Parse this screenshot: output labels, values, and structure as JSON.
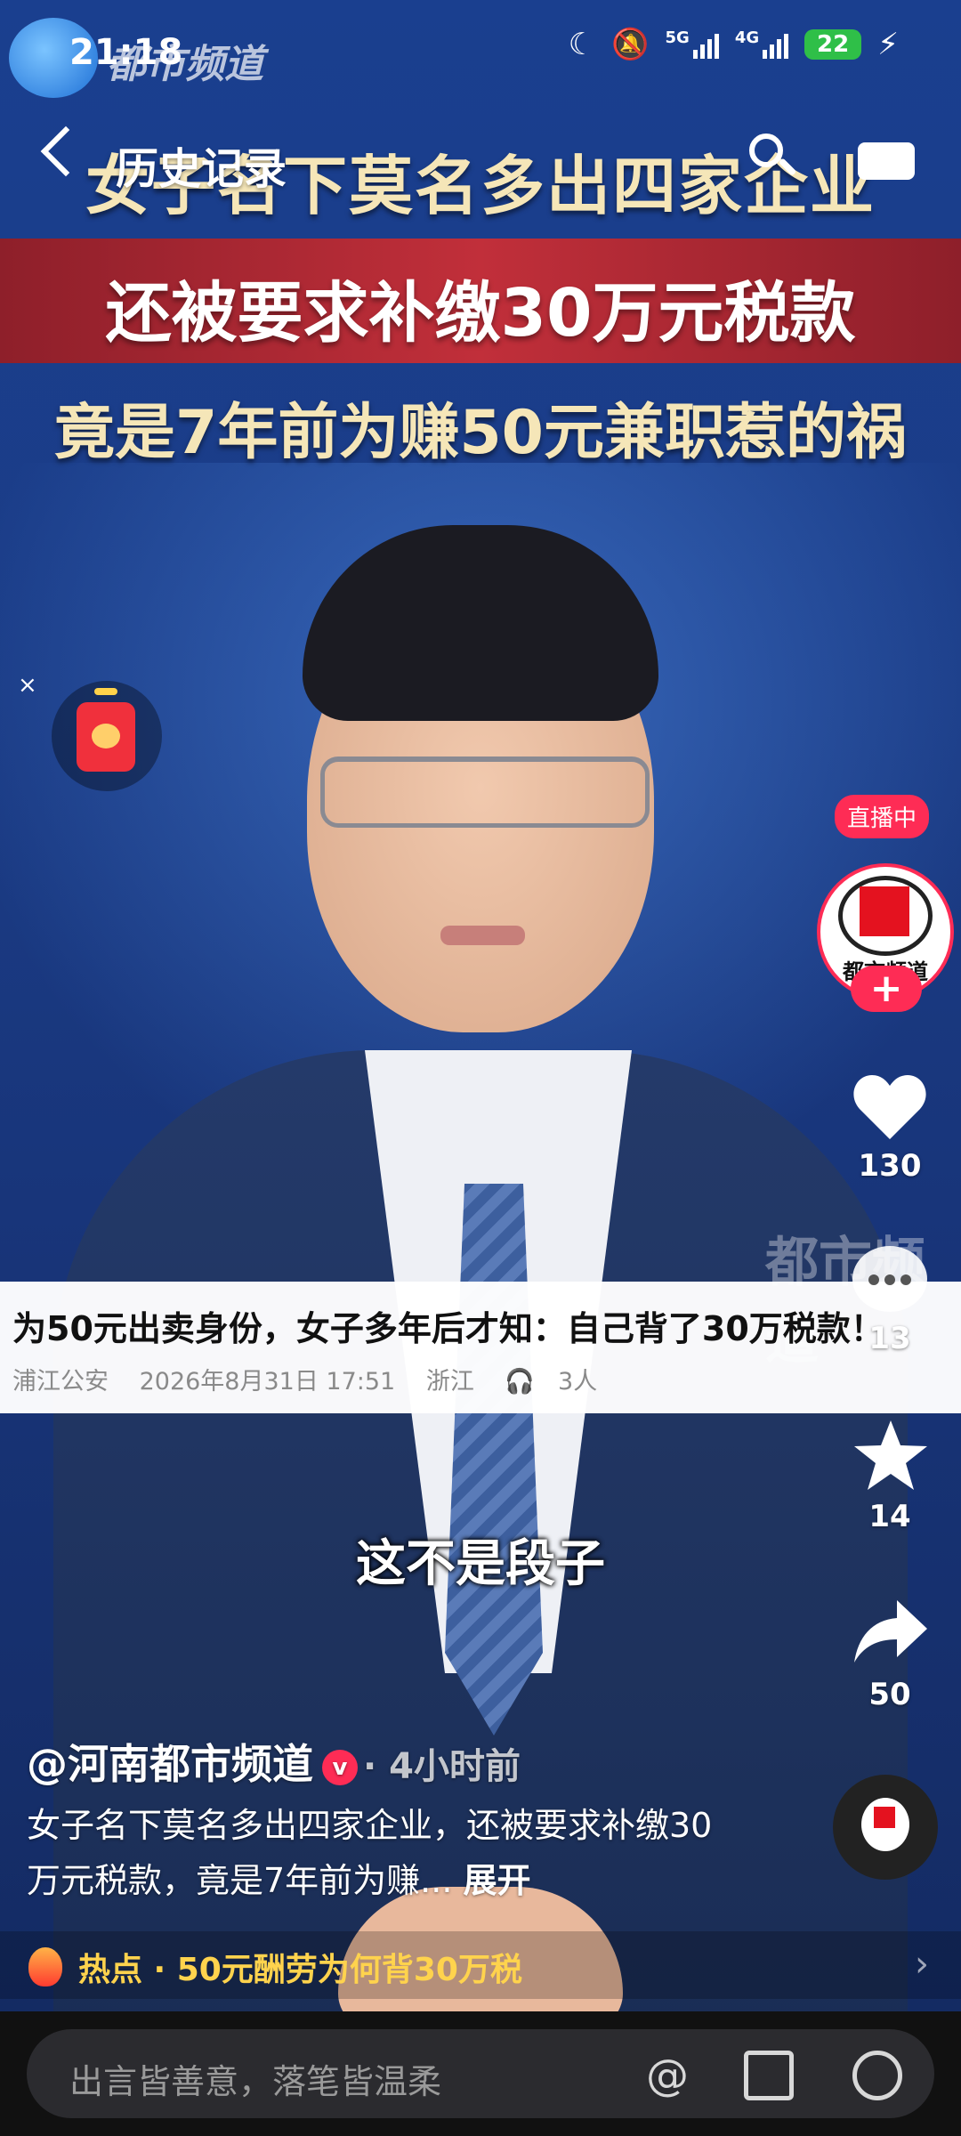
{
  "status_bar": {
    "time": "21:18",
    "network_5g": "5G",
    "network_4g": "4G",
    "battery": "22"
  },
  "channel_logo_text": "都市频道",
  "nav": {
    "title": "历史记录"
  },
  "video": {
    "headline_1": "女子名下莫名多出四家企业",
    "headline_2": "还被要求补缴30万元税款",
    "headline_3": "竟是7年前为赚50元兼职惹的祸",
    "subtitle": "这不是段子",
    "watermark": "都市频道"
  },
  "news_card": {
    "title": "为50元出卖身份，女子多年后才知：自己背了30万税款！",
    "source": "浦江公安",
    "datetime": "2026年8月31日 17:51",
    "location": "浙江",
    "listeners": "3人"
  },
  "red_packet": {
    "close": "×"
  },
  "sidebar": {
    "live_badge": "直播中",
    "avatar_text": "都市频道",
    "follow": "+",
    "likes": "130",
    "comments": "13",
    "favorites": "14",
    "shares": "50"
  },
  "post": {
    "author": "@河南都市频道",
    "verified": "v",
    "time_ago": "· 4小时前",
    "description": "女子名下莫名多出四家企业，还被要求补缴30万元税款，竟是7年前为赚...",
    "expand": "展开"
  },
  "hot_topic": {
    "label": "热点 · 50元酬劳为何背30万税",
    "chevron": "›"
  },
  "comment_bar": {
    "placeholder": "出言皆善意，落笔皆温柔",
    "at": "@"
  }
}
